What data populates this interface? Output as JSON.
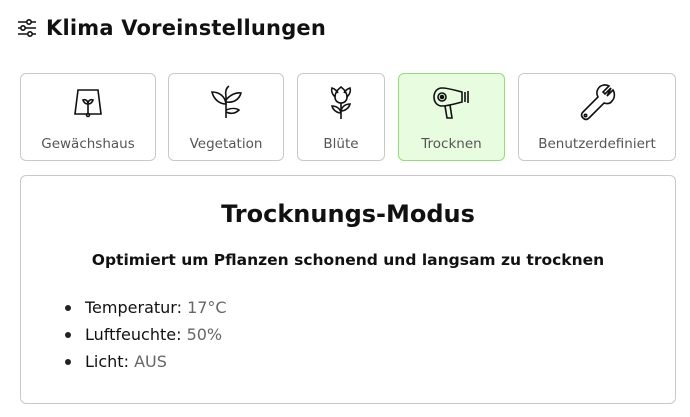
{
  "header": {
    "icon": "sliders-icon",
    "title": "Klima Voreinstellungen"
  },
  "presets": [
    {
      "label": "Gewächshaus",
      "icon": "greenhouse-icon",
      "active": false
    },
    {
      "label": "Vegetation",
      "icon": "plant-icon",
      "active": false
    },
    {
      "label": "Blüte",
      "icon": "flower-icon",
      "active": false
    },
    {
      "label": "Trocknen",
      "icon": "hair-dryer-icon",
      "active": true
    },
    {
      "label": "Benutzerdefiniert",
      "icon": "wrench-icon",
      "active": false
    }
  ],
  "panel": {
    "title": "Trocknungs-Modus",
    "description": "Optimiert um Pflanzen schonend und langsam zu trocknen",
    "settings": [
      {
        "key": "Temperatur:",
        "value": "17°C"
      },
      {
        "key": "Luftfeuchte:",
        "value": "50%"
      },
      {
        "key": "Licht:",
        "value": "AUS"
      }
    ]
  },
  "colors": {
    "active_bg": "#e8fce0",
    "active_border": "#8fe07a",
    "border": "#c9c9c9"
  }
}
